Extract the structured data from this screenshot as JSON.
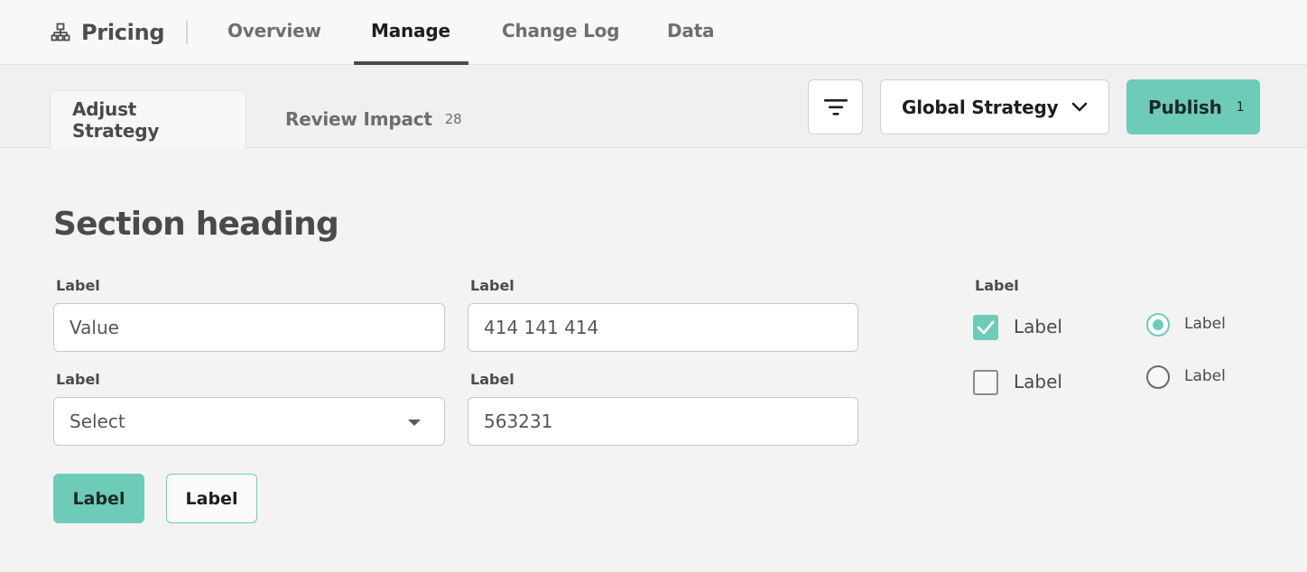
{
  "nav": {
    "title": "Pricing",
    "tabs": [
      {
        "label": "Overview"
      },
      {
        "label": "Manage",
        "active": true
      },
      {
        "label": "Change Log"
      },
      {
        "label": "Data"
      }
    ]
  },
  "toolbar": {
    "tabs": [
      {
        "label": "Adjust Strategy",
        "active": true
      },
      {
        "label": "Review Impact",
        "badge": "28"
      }
    ],
    "strategy_select": {
      "value": "Global Strategy"
    },
    "publish": {
      "label": "Publish",
      "count": "1"
    }
  },
  "main": {
    "heading": "Section heading",
    "fields": [
      {
        "label": "Label",
        "value": "Value"
      },
      {
        "label": "Label",
        "value": "414 141 414"
      },
      {
        "label": "Label",
        "value": "Select",
        "type": "select"
      },
      {
        "label": "Label",
        "value": "563231"
      }
    ],
    "options": {
      "label": "Label",
      "checkboxes": [
        {
          "label": "Label",
          "checked": true
        },
        {
          "label": "Label",
          "checked": false
        }
      ],
      "radios": [
        {
          "label": "Label",
          "selected": true
        },
        {
          "label": "Label",
          "selected": false
        }
      ]
    },
    "buttons": {
      "primary": "Label",
      "secondary": "Label"
    }
  },
  "colors": {
    "accent": "#6dcbb8",
    "background": "#f3f3f3",
    "text": "#4a4a4a"
  }
}
